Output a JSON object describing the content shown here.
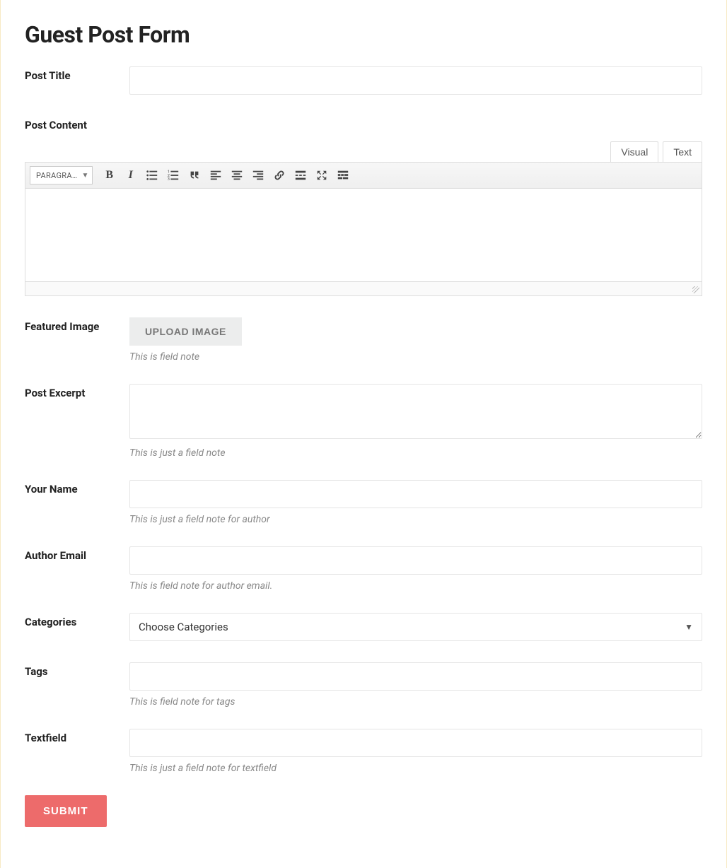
{
  "page_title": "Guest Post Form",
  "fields": {
    "post_title": {
      "label": "Post Title",
      "value": ""
    },
    "post_content": {
      "label": "Post Content"
    },
    "featured_image": {
      "label": "Featured Image",
      "button": "UPLOAD IMAGE",
      "note": "This is field note"
    },
    "post_excerpt": {
      "label": "Post Excerpt",
      "value": "",
      "note": "This is just a field note"
    },
    "your_name": {
      "label": "Your Name",
      "value": "",
      "note": "This is just a field note for author"
    },
    "author_email": {
      "label": "Author Email",
      "value": "",
      "note": "This is field note for author email."
    },
    "categories": {
      "label": "Categories",
      "placeholder": "Choose Categories"
    },
    "tags": {
      "label": "Tags",
      "value": "",
      "note": "This is field note for tags"
    },
    "textfield": {
      "label": "Textfield",
      "value": "",
      "note": "This is just a field note for textfield"
    }
  },
  "editor": {
    "tabs": {
      "visual": "Visual",
      "text": "Text"
    },
    "format_dropdown": "PARAGRA…",
    "toolbar_icons": [
      "bold",
      "italic",
      "unordered-list",
      "ordered-list",
      "blockquote",
      "align-left",
      "align-center",
      "align-right",
      "link",
      "read-more",
      "fullscreen",
      "toolbar-toggle"
    ]
  },
  "submit_label": "SUBMIT"
}
